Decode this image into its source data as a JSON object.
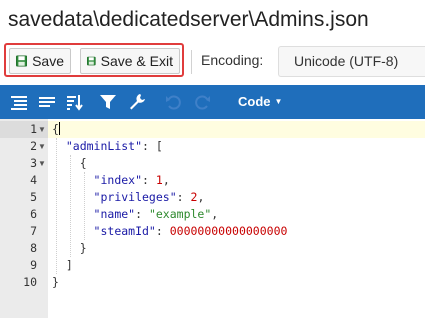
{
  "window": {
    "title": "savedata\\dedicatedserver\\Admins.json"
  },
  "toolbar": {
    "save_label": "Save",
    "save_exit_label": "Save & Exit",
    "encoding_label": "Encoding:",
    "encoding_value": "Unicode (UTF-8)",
    "highlight_color": "#e03c3c"
  },
  "menubar": {
    "background": "#1f6ebb",
    "icons": [
      "format-icon",
      "compact-icon",
      "sort-icon",
      "filter-icon",
      "repair-icon",
      "undo-icon",
      "redo-icon"
    ],
    "mode_label": "Code"
  },
  "editor": {
    "line_numbers": [
      "1",
      "2",
      "3",
      "4",
      "5",
      "6",
      "7",
      "8",
      "9",
      "10"
    ],
    "lines": [
      [
        {
          "t": "{",
          "c": "tk-p"
        }
      ],
      [
        {
          "t": "  ",
          "c": "tk-p"
        },
        {
          "t": "\"adminList\"",
          "c": "tk-key"
        },
        {
          "t": ": [",
          "c": "tk-p"
        }
      ],
      [
        {
          "t": "    {",
          "c": "tk-p"
        }
      ],
      [
        {
          "t": "      ",
          "c": "tk-p"
        },
        {
          "t": "\"index\"",
          "c": "tk-key"
        },
        {
          "t": ": ",
          "c": "tk-p"
        },
        {
          "t": "1",
          "c": "tk-num"
        },
        {
          "t": ",",
          "c": "tk-p"
        }
      ],
      [
        {
          "t": "      ",
          "c": "tk-p"
        },
        {
          "t": "\"privileges\"",
          "c": "tk-key"
        },
        {
          "t": ": ",
          "c": "tk-p"
        },
        {
          "t": "2",
          "c": "tk-num"
        },
        {
          "t": ",",
          "c": "tk-p"
        }
      ],
      [
        {
          "t": "      ",
          "c": "tk-p"
        },
        {
          "t": "\"name\"",
          "c": "tk-key"
        },
        {
          "t": ": ",
          "c": "tk-p"
        },
        {
          "t": "\"example\"",
          "c": "tk-str"
        },
        {
          "t": ",",
          "c": "tk-p"
        }
      ],
      [
        {
          "t": "      ",
          "c": "tk-p"
        },
        {
          "t": "\"steamId\"",
          "c": "tk-key"
        },
        {
          "t": ": ",
          "c": "tk-p"
        },
        {
          "t": "00000000000000000",
          "c": "tk-num"
        }
      ],
      [
        {
          "t": "    }",
          "c": "tk-p"
        }
      ],
      [
        {
          "t": "  ]",
          "c": "tk-p"
        }
      ],
      [
        {
          "t": "}",
          "c": "tk-p"
        }
      ]
    ],
    "foldable_lines": [
      "1",
      "2",
      "3"
    ]
  }
}
